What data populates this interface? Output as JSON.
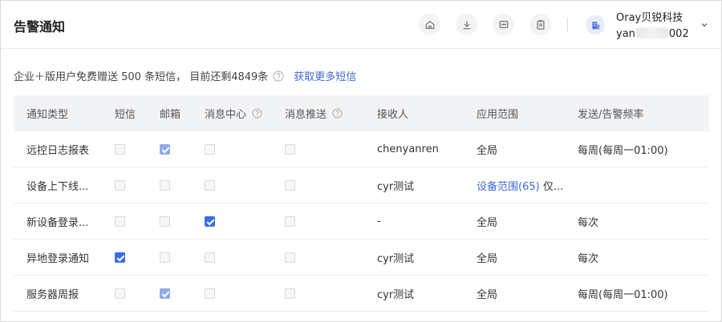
{
  "header": {
    "title": "告警通知",
    "icons": [
      "home-icon",
      "download-icon",
      "message-icon",
      "clipboard-icon"
    ],
    "user": {
      "org": "Oray贝锐科技",
      "id_prefix": "yan",
      "id_suffix": "002"
    }
  },
  "notice": {
    "text": "企业＋版用户免费赠送 500 条短信， 目前还剩4849条",
    "link": "获取更多短信"
  },
  "table": {
    "headers": {
      "type": "通知类型",
      "sms": "短信",
      "email": "邮箱",
      "center": "消息中心",
      "push": "消息推送",
      "receiver": "接收人",
      "scope": "应用范围",
      "freq": "发送/告警频率"
    },
    "rows": [
      {
        "type": "远控日志报表",
        "sms": false,
        "email": true,
        "email_dim": true,
        "center": false,
        "push": false,
        "receiver": "chenyanren",
        "scope": "全局",
        "scope_link": "",
        "scope_suffix": "",
        "freq": "每周(每周一01:00)"
      },
      {
        "type": "设备上下线...",
        "sms": false,
        "email": false,
        "center": false,
        "push": false,
        "receiver": "cyr测试",
        "scope": "",
        "scope_link": "设备范围(65)",
        "scope_suffix": " 仅...",
        "freq": ""
      },
      {
        "type": "新设备登录...",
        "sms": false,
        "email": false,
        "center": true,
        "push": false,
        "receiver": "-",
        "scope": "全局",
        "scope_link": "",
        "scope_suffix": "",
        "freq": "每次"
      },
      {
        "type": "异地登录通知",
        "sms": true,
        "email": false,
        "center": false,
        "push": false,
        "receiver": "cyr测试",
        "scope": "全局",
        "scope_link": "",
        "scope_suffix": "",
        "freq": "每次"
      },
      {
        "type": "服务器周报",
        "sms": false,
        "email": true,
        "email_dim": true,
        "center": false,
        "push": false,
        "receiver": "cyr测试",
        "scope": "全局",
        "scope_link": "",
        "scope_suffix": "",
        "freq": "每周(每周一01:00)"
      }
    ]
  },
  "colors": {
    "accent": "#3b6fe0",
    "link": "#3f6ad8",
    "header_bg": "#f2f3f5"
  }
}
